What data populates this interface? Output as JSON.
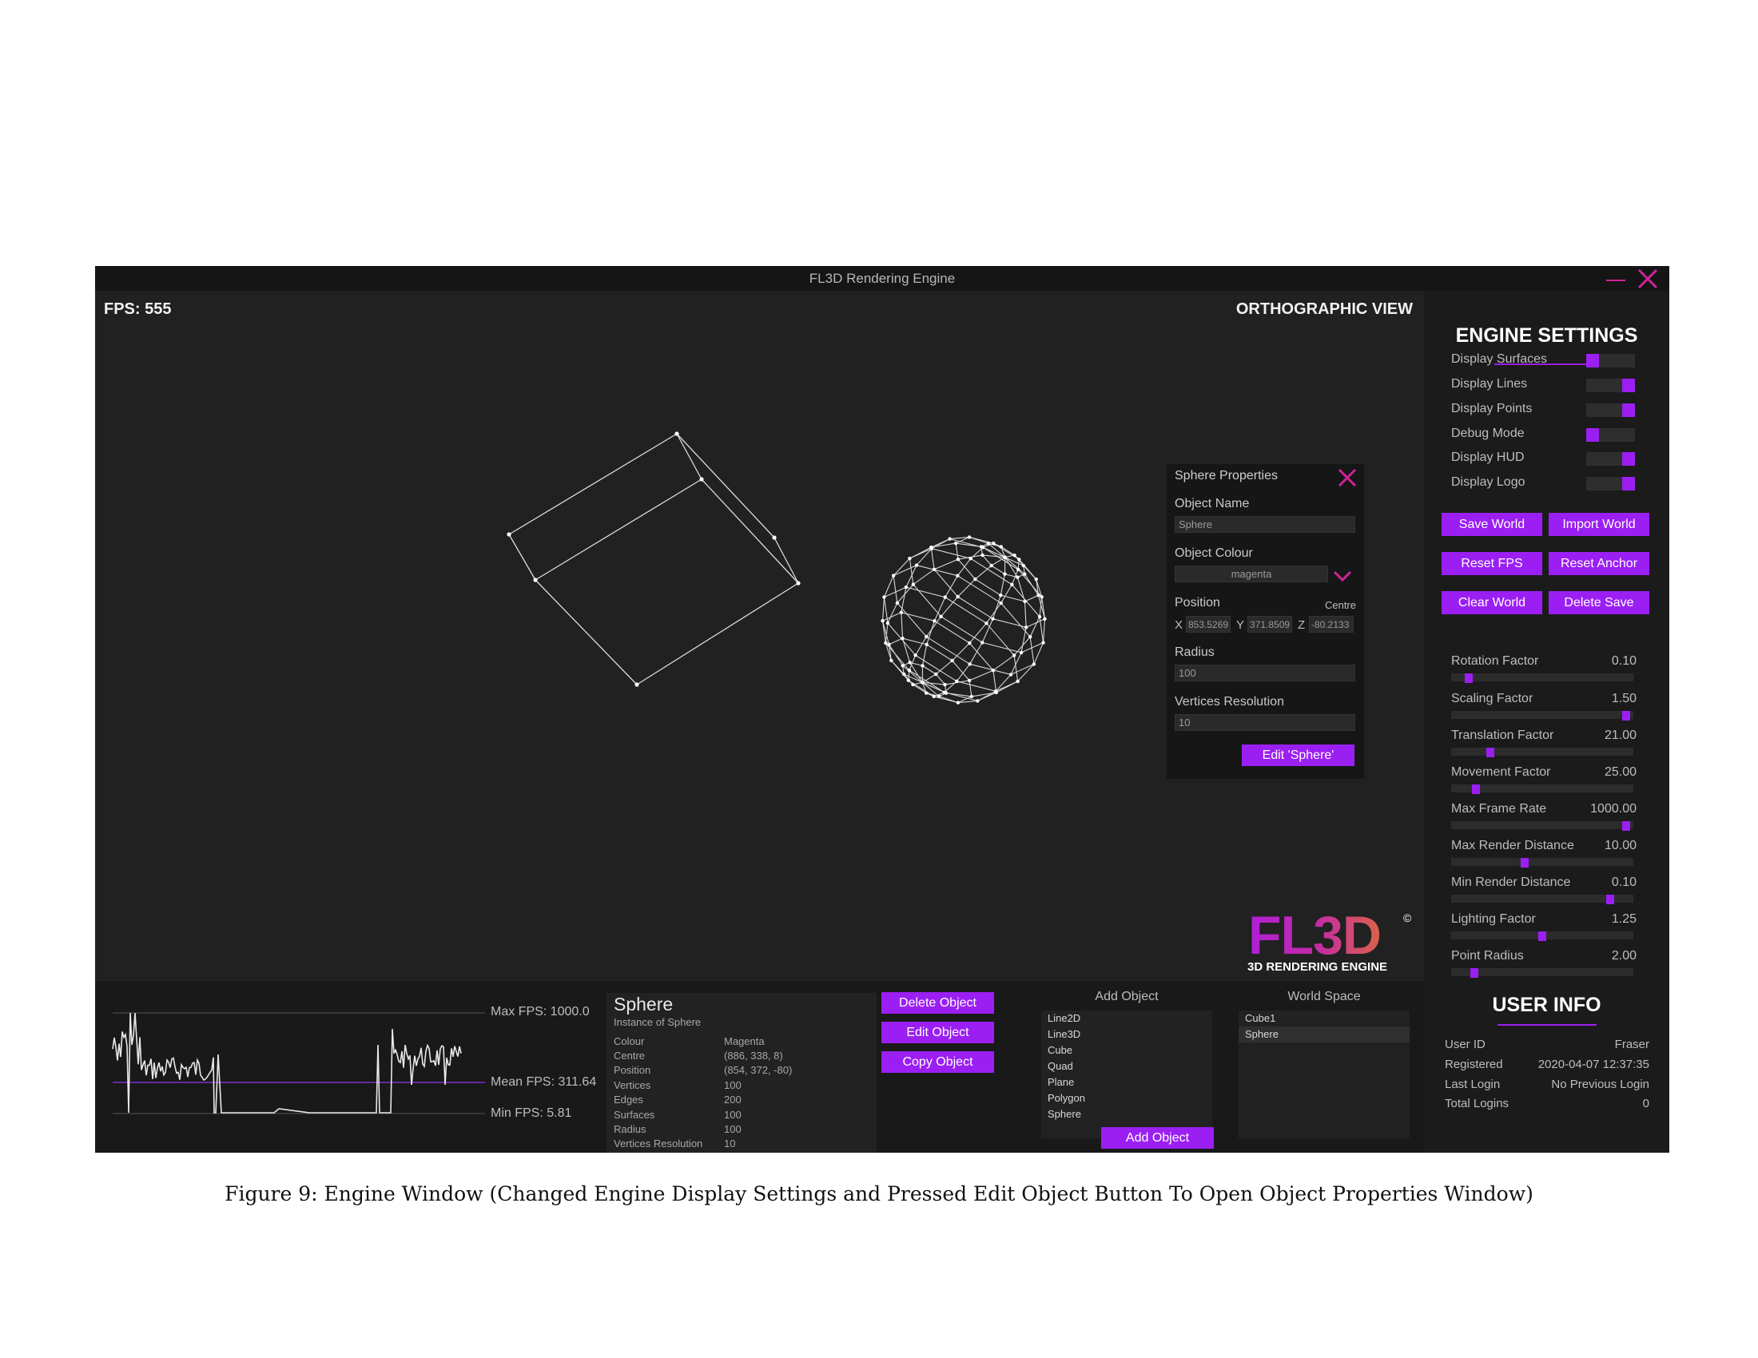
{
  "window": {
    "title": "FL3D Rendering Engine",
    "minimize_icon": "minimize-icon",
    "close_icon": "close-icon"
  },
  "viewport": {
    "fps_text": "FPS: 555",
    "view_mode": "ORTHOGRAPHIC VIEW",
    "accent": "#9b1ff2",
    "close_color": "#d0229a"
  },
  "properties": {
    "title": "Sphere Properties",
    "name_label": "Object Name",
    "name_value": "Sphere",
    "colour_label": "Object Colour",
    "colour_value": "magenta",
    "position_label": "Position",
    "centre_label": "Centre",
    "x_label": "X",
    "x_value": "853.5269",
    "y_label": "Y",
    "y_value": "371.8509",
    "z_label": "Z",
    "z_value": "-80.2133",
    "radius_label": "Radius",
    "radius_value": "100",
    "resolution_label": "Vertices Resolution",
    "resolution_value": "10",
    "edit_button": "Edit 'Sphere'"
  },
  "logo": {
    "mark": "FL3D",
    "copyright": "©",
    "subtitle": "3D RENDERING ENGINE"
  },
  "fps_graph": {
    "max_label": "Max FPS: 1000.0",
    "mean_label": "Mean FPS: 311.64",
    "min_label": "Min FPS: 5.81"
  },
  "object_info": {
    "title": "Sphere",
    "subtitle": "Instance of Sphere",
    "rows": [
      {
        "key": "Colour",
        "value": "Magenta"
      },
      {
        "key": "Centre",
        "value": "(886, 338, 8)"
      },
      {
        "key": "Position",
        "value": "(854, 372, -80)"
      },
      {
        "key": "Vertices",
        "value": "100"
      },
      {
        "key": "Edges",
        "value": "200"
      },
      {
        "key": "Surfaces",
        "value": "100"
      },
      {
        "key": "Radius",
        "value": "100"
      },
      {
        "key": "Vertices Resolution",
        "value": "10"
      }
    ]
  },
  "object_buttons": {
    "delete": "Delete Object",
    "edit": "Edit Object",
    "copy": "Copy Object"
  },
  "add_object": {
    "title": "Add Object",
    "items": [
      "Line2D",
      "Line3D",
      "Cube",
      "Quad",
      "Plane",
      "Polygon",
      "Sphere"
    ],
    "button": "Add Object"
  },
  "world_space": {
    "title": "World Space",
    "items": [
      "Cube1",
      "Sphere"
    ],
    "selected": "Sphere"
  },
  "engine_settings": {
    "title": "ENGINE SETTINGS",
    "toggles": [
      {
        "label": "Display Surfaces",
        "on": false
      },
      {
        "label": "Display Lines",
        "on": true
      },
      {
        "label": "Display Points",
        "on": true
      },
      {
        "label": "Debug Mode",
        "on": false
      },
      {
        "label": "Display HUD",
        "on": true
      },
      {
        "label": "Display Logo",
        "on": true
      }
    ],
    "buttons": {
      "save_world": "Save World",
      "import_world": "Import World",
      "reset_fps": "Reset FPS",
      "reset_anchor": "Reset Anchor",
      "clear_world": "Clear World",
      "delete_save": "Delete Save"
    },
    "sliders": [
      {
        "label": "Rotation Factor",
        "value": "0.10",
        "fraction": 0.08
      },
      {
        "label": "Scaling Factor",
        "value": "1.50",
        "fraction": 0.98
      },
      {
        "label": "Translation Factor",
        "value": "21.00",
        "fraction": 0.2
      },
      {
        "label": "Movement Factor",
        "value": "25.00",
        "fraction": 0.12
      },
      {
        "label": "Max Frame Rate",
        "value": "1000.00",
        "fraction": 0.98
      },
      {
        "label": "Max Render Distance",
        "value": "10.00",
        "fraction": 0.4
      },
      {
        "label": "Min Render Distance",
        "value": "0.10",
        "fraction": 0.89
      },
      {
        "label": "Lighting Factor",
        "value": "1.25",
        "fraction": 0.5
      },
      {
        "label": "Point Radius",
        "value": "2.00",
        "fraction": 0.11
      }
    ]
  },
  "user_info": {
    "title": "USER INFO",
    "rows": [
      {
        "key": "User ID",
        "value": "Fraser"
      },
      {
        "key": "Registered",
        "value": "2020-04-07 12:37:35"
      },
      {
        "key": "Last Login",
        "value": "No Previous Login"
      },
      {
        "key": "Total Logins",
        "value": "0"
      }
    ]
  },
  "caption": "Figure 9: Engine Window (Changed Engine Display Settings and Pressed Edit Object Button To Open Object Properties Window)"
}
